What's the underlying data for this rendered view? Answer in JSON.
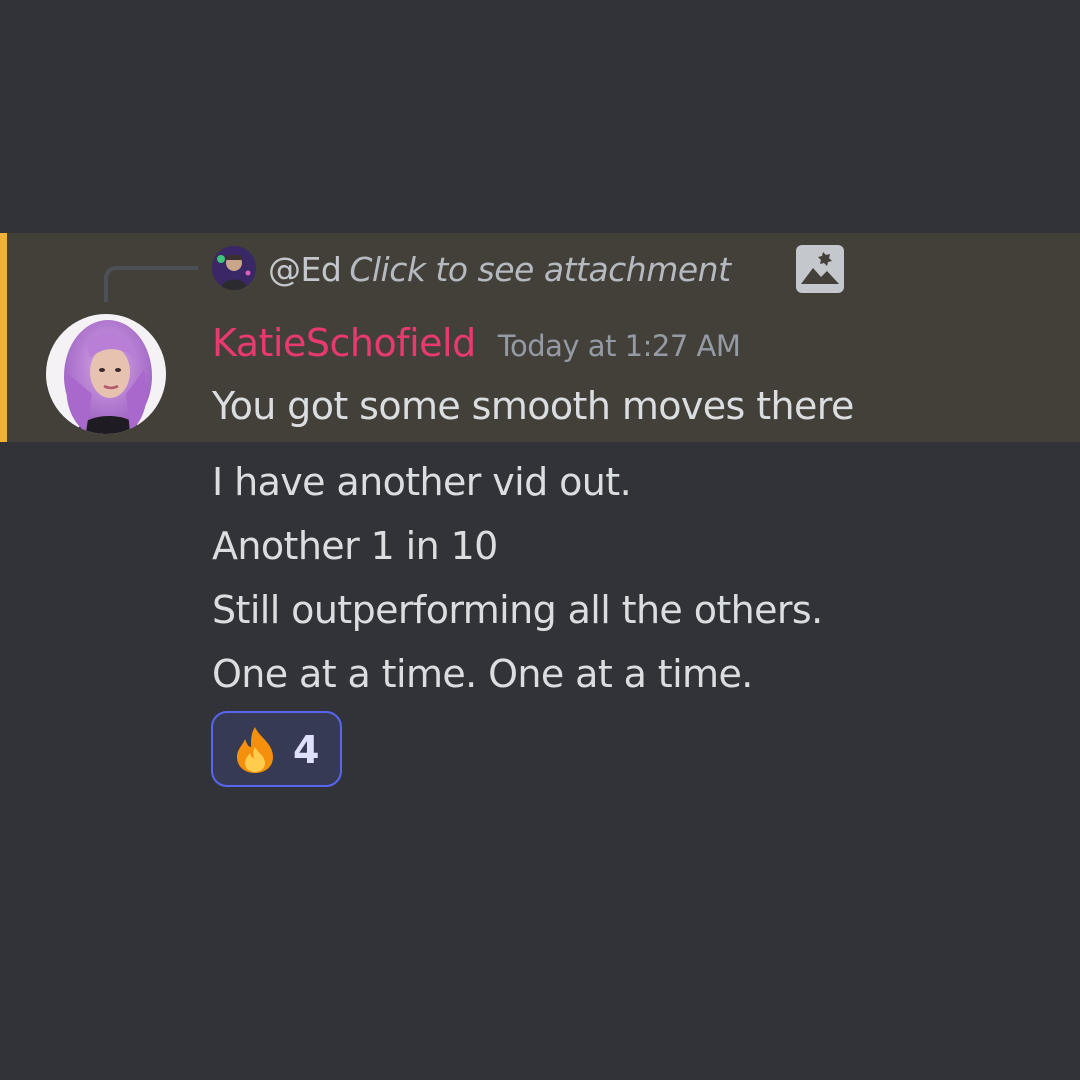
{
  "reply": {
    "author": "@Ed",
    "text": "Click to see attachment",
    "attachment_icon": "image-icon"
  },
  "message": {
    "username": "KatieSchofield",
    "timestamp": "Today at 1:27 AM",
    "lines": [
      "You got some smooth moves there",
      "I have another vid out.",
      "Another 1 in 10",
      "Still outperforming all the others.",
      "One at a time. One at a time."
    ]
  },
  "reaction": {
    "emoji": "fire-emoji",
    "count": "4"
  },
  "colors": {
    "background": "#313338",
    "highlight": "#433f39",
    "highlight_bar": "#f0b232",
    "username": "#e83a6e",
    "reaction_border": "#5865f2"
  }
}
